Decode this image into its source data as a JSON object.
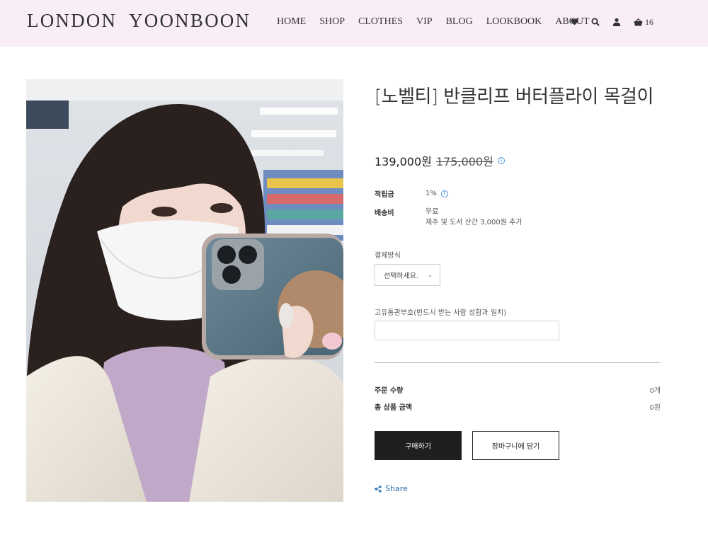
{
  "header": {
    "logo": "LONDON  YOONBOON",
    "nav": [
      "HOME",
      "SHOP",
      "CLOTHES",
      "VIP",
      "BLOG",
      "LOOKBOOK",
      "ABOUT"
    ],
    "icons": [
      "heart-icon",
      "search-icon",
      "user-icon",
      "basket-icon"
    ],
    "cart_count": "16",
    "background": "#f9eef7"
  },
  "product": {
    "title": "[노벨티] 반클리프 버터플라이 목걸이",
    "price": "139,000원",
    "original_price": "175,000원",
    "info_icon": "i",
    "reward_label": "적립금",
    "reward_value": "1%",
    "shipping_label": "배송비",
    "shipping_value": "무료",
    "shipping_note": "제주 및 도서 산간 3,000원 추가",
    "payment_label": "결제방식",
    "payment_select": "선택하세요.",
    "customs_label": "고유통관부호(반드시 받는 사람 성함과 일치)",
    "customs_value": "",
    "qty_label": "주문 수량",
    "qty_value": "0개",
    "total_label": "총 상품 금액",
    "total_value": "0원",
    "buy_button": "구매하기",
    "cart_button": "장바구니에 담기",
    "share": "Share"
  },
  "colors": {
    "header_bg": "#f9eef7",
    "buy_button_bg": "#1f1f1f",
    "link": "#2a6fb0",
    "info_icon": "#4a90d9"
  }
}
